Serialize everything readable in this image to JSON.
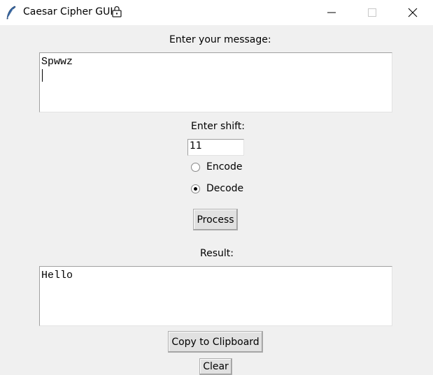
{
  "window": {
    "title": "Caesar Cipher GUI",
    "title_icon": "feather-icon",
    "title_extra_icon": "shield-lock-icon",
    "controls": [
      "minimize-icon",
      "maximize-icon",
      "close-icon"
    ]
  },
  "message": {
    "label": "Enter your message:",
    "value": "Spwwz"
  },
  "shift": {
    "label": "Enter shift:",
    "value": "11"
  },
  "mode": {
    "options": [
      {
        "label": "Encode",
        "selected": false
      },
      {
        "label": "Decode",
        "selected": true
      }
    ]
  },
  "actions": {
    "process_label": "Process",
    "copy_label": "Copy to Clipboard",
    "clear_label": "Clear"
  },
  "result": {
    "label": "Result:",
    "value": "Hello"
  }
}
